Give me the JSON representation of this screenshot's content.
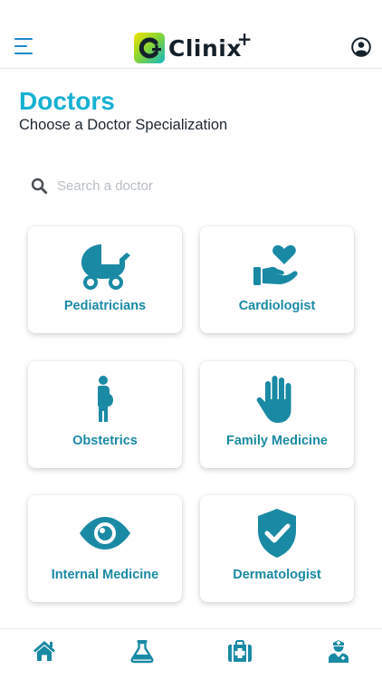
{
  "header": {
    "brand_name": "Clinix",
    "brand_plus": "+",
    "menu_icon": "hamburger-menu-icon",
    "profile_icon": "user-circle-icon"
  },
  "page": {
    "title": "Doctors",
    "subtitle": "Choose a Doctor Specialization"
  },
  "search": {
    "placeholder": "Search a doctor",
    "value": "",
    "icon": "search-icon"
  },
  "specializations": [
    {
      "label": "Pediatricians",
      "icon": "baby-carriage-icon"
    },
    {
      "label": "Cardiologist",
      "icon": "hand-holding-heart-icon"
    },
    {
      "label": "Obstetrics",
      "icon": "pregnant-person-icon"
    },
    {
      "label": "Family Medicine",
      "icon": "hand-paper-icon"
    },
    {
      "label": "Internal Medicine",
      "icon": "eye-icon"
    },
    {
      "label": "Dermatologist",
      "icon": "shield-check-icon"
    }
  ],
  "tabbar": [
    {
      "icon": "home-icon"
    },
    {
      "icon": "flask-icon"
    },
    {
      "icon": "first-aid-kit-icon"
    },
    {
      "icon": "doctor-icon"
    }
  ],
  "colors": {
    "accent_title": "#16b1d2",
    "icon_teal": "#1a8aa4",
    "nav_blue": "#1d86c8",
    "text_dark": "#1c2630"
  }
}
